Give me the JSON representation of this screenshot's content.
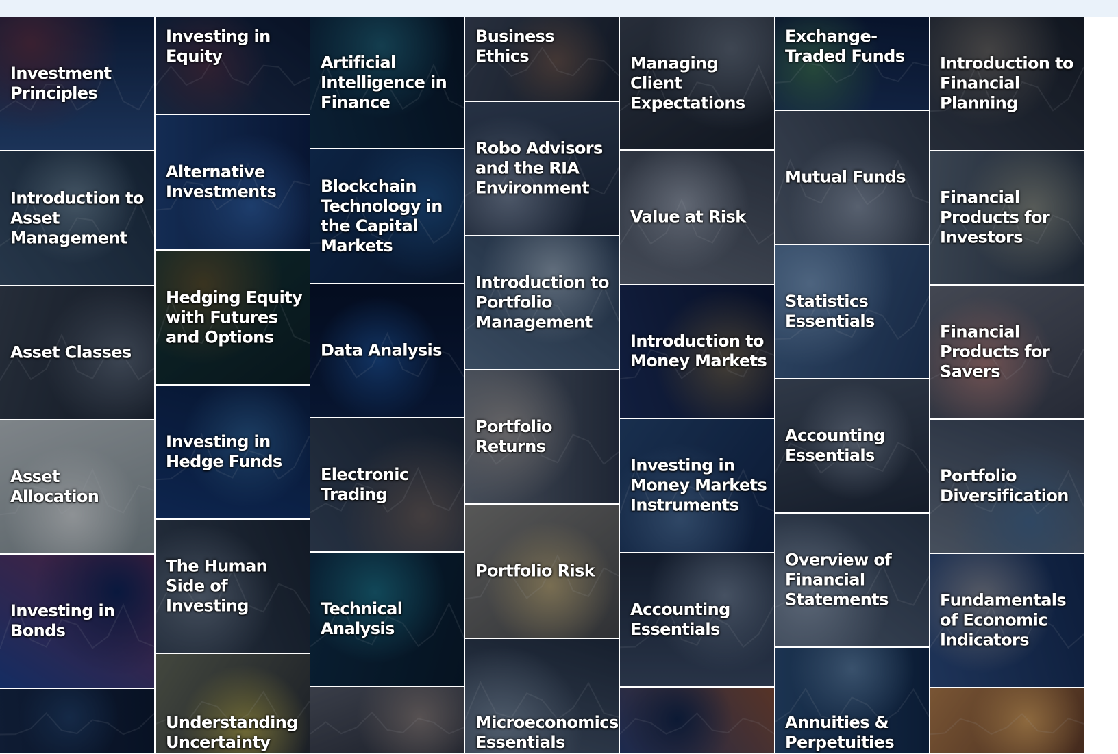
{
  "columns": [
    [
      {
        "title": "Investment Principles",
        "palette": [
          "#2a4a7a",
          "#0e1d3a",
          "#5a2a3a"
        ]
      },
      {
        "title": "Introduction to Asset Management",
        "palette": [
          "#3b4f62",
          "#1c2a38",
          "#6a7f8c"
        ]
      },
      {
        "title": "Asset Classes",
        "palette": [
          "#3a4048",
          "#191d24",
          "#5e6670"
        ]
      },
      {
        "title": "Asset Allocation",
        "palette": [
          "#c9ccc8",
          "#8d9693",
          "#e2e2dc"
        ]
      },
      {
        "title": "Investing in Bonds",
        "palette": [
          "#1e3f8a",
          "#7a2a4a",
          "#0c1e4e"
        ]
      },
      {
        "title": "",
        "palette": [
          "#15243f",
          "#0a1325",
          "#1f3a5e"
        ]
      }
    ],
    [
      {
        "title": "Investing in Equity",
        "palette": [
          "#22324e",
          "#0b1428",
          "#4a2a3a"
        ]
      },
      {
        "title": "Alternative Investments",
        "palette": [
          "#1d3e72",
          "#0b1a3d",
          "#2d5a9a"
        ]
      },
      {
        "title": "Hedging Equity with Futures and Options",
        "palette": [
          "#14352e",
          "#0a1a18",
          "#5a4a20"
        ]
      },
      {
        "title": "Investing in Hedge Funds",
        "palette": [
          "#13336a",
          "#091a3a",
          "#2b5a8a"
        ]
      },
      {
        "title": "The Human Side of Investing",
        "palette": [
          "#3a4450",
          "#1a2028",
          "#6a7480"
        ]
      },
      {
        "title": "Understanding Uncertainty",
        "palette": [
          "#6a6a50",
          "#2a2a2a",
          "#b0a040"
        ]
      }
    ],
    [
      {
        "title": "Artificial Intelligence in Finance",
        "palette": [
          "#0e2a3e",
          "#05101c",
          "#1d5a6a"
        ]
      },
      {
        "title": "Blockchain Technology in the Capital Markets",
        "palette": [
          "#123058",
          "#0a1830",
          "#1e4e80"
        ]
      },
      {
        "title": "Data Analysis",
        "palette": [
          "#0a1a3a",
          "#040b1e",
          "#1a4a8a"
        ]
      },
      {
        "title": "Electronic Trading",
        "palette": [
          "#3a4656",
          "#1a222e",
          "#6a5a50"
        ]
      },
      {
        "title": "Technical Analysis",
        "palette": [
          "#0d2a3e",
          "#061520",
          "#1a6a7a"
        ]
      },
      {
        "title": "",
        "palette": [
          "#5a5a60",
          "#2a2a30",
          "#8a7a70"
        ]
      }
    ],
    [
      {
        "title": "Business Ethics",
        "palette": [
          "#3e4450",
          "#1a1e26",
          "#6a5040"
        ]
      },
      {
        "title": "Robo Advisors and the RIA Environment",
        "palette": [
          "#3a4658",
          "#1c2432",
          "#7a8494"
        ]
      },
      {
        "title": "Introduction to Portfolio Management",
        "palette": [
          "#5a7086",
          "#2a3a4e",
          "#9aa8b4"
        ]
      },
      {
        "title": "Portfolio Returns",
        "palette": [
          "#6e737a",
          "#2e3440",
          "#a09890"
        ]
      },
      {
        "title": "Portfolio Risk",
        "palette": [
          "#8a8478",
          "#4a4640",
          "#c0a870"
        ]
      },
      {
        "title": "Microeconomics Essentials",
        "palette": [
          "#4e5a6a",
          "#222a36",
          "#7a8896"
        ]
      }
    ],
    [
      {
        "title": "Managing Client Expectations",
        "palette": [
          "#3c4048",
          "#181b20",
          "#626870"
        ]
      },
      {
        "title": "Value at Risk",
        "palette": [
          "#6a6e76",
          "#3a3e46",
          "#9a9ea6"
        ]
      },
      {
        "title": "Introduction to Money Markets",
        "palette": [
          "#1a2850",
          "#0a1028",
          "#6a5a40"
        ]
      },
      {
        "title": "Investing in Money Markets Instruments",
        "palette": [
          "#25436a",
          "#0f2040",
          "#4a6a90"
        ]
      },
      {
        "title": "Accounting Essentials",
        "palette": [
          "#3e4a5e",
          "#1a2230",
          "#6e7a8a"
        ]
      },
      {
        "title": "",
        "palette": [
          "#2a3a6a",
          "#8a4a2a",
          "#102040"
        ]
      }
    ],
    [
      {
        "title": "Exchange-Traded Funds",
        "palette": [
          "#1a3058",
          "#0a1630",
          "#3a6a4a"
        ]
      },
      {
        "title": "Mutual Funds",
        "palette": [
          "#5a626e",
          "#2e343e",
          "#8a929e"
        ]
      },
      {
        "title": "Statistics Essentials",
        "palette": [
          "#4a6a8e",
          "#22385a",
          "#7a98b8"
        ]
      },
      {
        "title": "Accounting Essentials",
        "palette": [
          "#4a525e",
          "#1e242e",
          "#7a828e"
        ]
      },
      {
        "title": "Overview of Financial Statements",
        "palette": [
          "#5e6a7a",
          "#2e3846",
          "#8e9aa8"
        ]
      },
      {
        "title": "Annuities & Perpetuities",
        "palette": [
          "#2a4a6e",
          "#0f2440",
          "#5a7a9a"
        ]
      }
    ],
    [
      {
        "title": "Introduction to Financial Planning",
        "palette": [
          "#3a3e46",
          "#181a1e",
          "#6a6258"
        ]
      },
      {
        "title": "Financial Products for Investors",
        "palette": [
          "#5a646e",
          "#2a323c",
          "#8a8a7a"
        ]
      },
      {
        "title": "Financial Products for Savers",
        "palette": [
          "#6a6a70",
          "#3a3a42",
          "#b07a70"
        ]
      },
      {
        "title": "Portfolio Diversification",
        "palette": [
          "#6e7680",
          "#3a4250",
          "#4a6a8a"
        ]
      },
      {
        "title": "Fundamentals of Economic Indicators",
        "palette": [
          "#2e4a7a",
          "#12264a",
          "#8a8a90"
        ]
      },
      {
        "title": "",
        "palette": [
          "#c08040",
          "#6a3a1a",
          "#e0a050"
        ]
      }
    ]
  ]
}
